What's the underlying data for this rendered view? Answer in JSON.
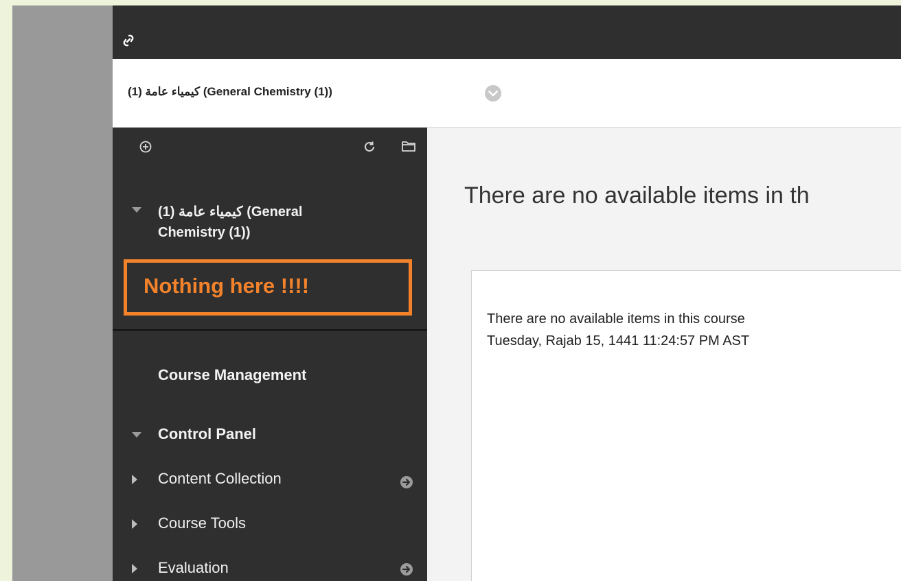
{
  "header": {
    "link_icon": "link-icon",
    "course_title": "كيمياء عامة (1) (General Chemistry (1))",
    "chevron_icon": "chevron-down-circle-icon"
  },
  "sidebar": {
    "toolbar": {
      "add_icon": "add-circle-icon",
      "refresh_icon": "refresh-icon",
      "folder_icon": "folder-icon"
    },
    "course_node": {
      "label_line1": "كيمياء عامة (1) (General",
      "label_line2": "Chemistry (1))"
    },
    "annotation": "Nothing here !!!!",
    "course_management_label": "Course Management",
    "control_panel_label": "Control Panel",
    "items": [
      {
        "label": "Content Collection",
        "has_go": true
      },
      {
        "label": "Course Tools",
        "has_go": false
      },
      {
        "label": "Evaluation",
        "has_go": true
      }
    ]
  },
  "main": {
    "heading": "There are no available items in th",
    "message_line1": "There are no available items in this course",
    "message_line2": "Tuesday, Rajab 15, 1441 11:24:57 PM AST"
  },
  "colors": {
    "dark_panel": "#2f2f2f",
    "annotation_orange": "#f3822b",
    "side_strip": "#999999",
    "background": "#eef3dc"
  }
}
